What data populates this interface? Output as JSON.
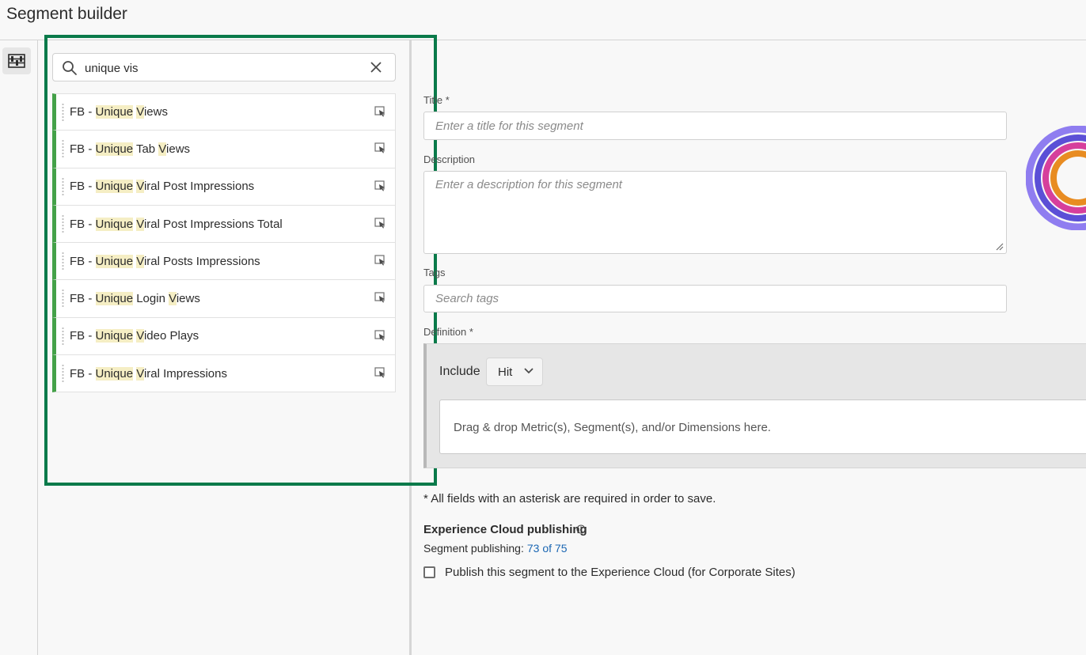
{
  "header": {
    "title": "Segment builder"
  },
  "rail": {
    "icon": "segment-builder-icon"
  },
  "search": {
    "value": "unique vis",
    "placeholder": "",
    "icon": "search-icon",
    "clear_icon": "close-icon"
  },
  "results": [
    {
      "parts": [
        [
          "FB - ",
          0
        ],
        [
          "Unique",
          1
        ],
        [
          " ",
          0
        ],
        [
          "V",
          1
        ],
        [
          "iews",
          0
        ]
      ]
    },
    {
      "parts": [
        [
          "FB - ",
          0
        ],
        [
          "Unique",
          1
        ],
        [
          " Tab ",
          0
        ],
        [
          "V",
          1
        ],
        [
          "iews",
          0
        ]
      ]
    },
    {
      "parts": [
        [
          "FB - ",
          0
        ],
        [
          "Unique",
          1
        ],
        [
          " ",
          0
        ],
        [
          "V",
          1
        ],
        [
          "iral Post Impressions",
          0
        ]
      ]
    },
    {
      "parts": [
        [
          "FB - ",
          0
        ],
        [
          "Unique",
          1
        ],
        [
          " ",
          0
        ],
        [
          "V",
          1
        ],
        [
          "iral Post Impressions Total",
          0
        ]
      ]
    },
    {
      "parts": [
        [
          "FB - ",
          0
        ],
        [
          "Unique",
          1
        ],
        [
          " ",
          0
        ],
        [
          "V",
          1
        ],
        [
          "iral Posts Impressions",
          0
        ]
      ]
    },
    {
      "parts": [
        [
          "FB - ",
          0
        ],
        [
          "Unique",
          1
        ],
        [
          " Login ",
          0
        ],
        [
          "V",
          1
        ],
        [
          "iews",
          0
        ]
      ]
    },
    {
      "parts": [
        [
          "FB - ",
          0
        ],
        [
          "Unique",
          1
        ],
        [
          " ",
          0
        ],
        [
          "V",
          1
        ],
        [
          "ideo Plays",
          0
        ]
      ]
    },
    {
      "parts": [
        [
          "FB - ",
          0
        ],
        [
          "Unique",
          1
        ],
        [
          " ",
          0
        ],
        [
          "V",
          1
        ],
        [
          "iral Impressions",
          0
        ]
      ]
    }
  ],
  "form": {
    "title_label": "Title",
    "title_placeholder": "Enter a title for this segment",
    "description_label": "Description",
    "description_placeholder": "Enter a description for this segment",
    "tags_label": "Tags",
    "tags_placeholder": "Search tags",
    "definition_label": "Definition",
    "required_marker": "*"
  },
  "definition": {
    "include_label": "Include",
    "scope_value": "Hit",
    "drop_text": "Drag & drop Metric(s), Segment(s), and/or Dimensions here."
  },
  "footer": {
    "required_note": "All fields with an asterisk are required in order to save.",
    "ec_title": "Experience Cloud publishing",
    "seg_publishing_label": "Segment publishing:",
    "seg_publishing_count": "73 of 75",
    "publish_label": "Publish this segment to the Experience Cloud (for Corporate Sites)"
  },
  "colors": {
    "highlight_border": "#0a7a4a",
    "result_accent": "#44a148",
    "match_highlight": "#f5eec4",
    "link": "#1b67b3",
    "ring_colors": [
      "#8f7df0",
      "#5b4fd6",
      "#d63f9c",
      "#e88c22"
    ]
  }
}
